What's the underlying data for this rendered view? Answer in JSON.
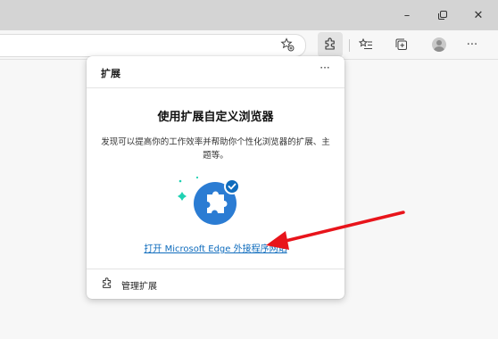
{
  "window": {
    "minimize_glyph": "–",
    "maximize_glyph": "▢",
    "close_glyph": "✕"
  },
  "toolbar": {
    "icons": [
      "favorite-add-icon",
      "extensions-icon",
      "favorites-icon",
      "collections-icon",
      "profile-icon",
      "more-icon"
    ],
    "more_glyph": "···"
  },
  "extensions_popup": {
    "title": "扩展",
    "more_glyph": "···",
    "headline": "使用扩展自定义浏览器",
    "description": "发现可以提高你的工作效率并帮助你个性化浏览器的扩展、主题等。",
    "store_link": "打开 Microsoft Edge 外接程序网站",
    "manage_label": "管理扩展"
  },
  "colors": {
    "accent": "#0f6cbd",
    "puzzle_blue": "#2b7cd3",
    "annotation_arrow": "#e8141b",
    "sparkle_teal": "#1fd1b2"
  }
}
